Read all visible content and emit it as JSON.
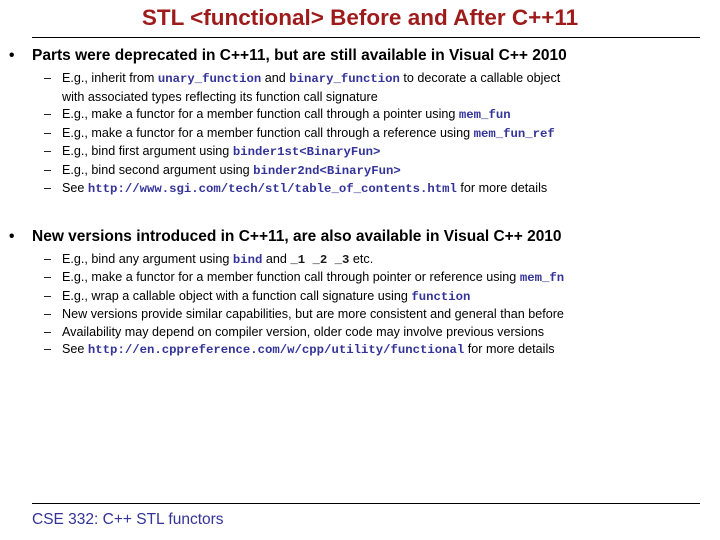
{
  "slide": {
    "title": "STL <functional> Before and After C++11",
    "title_color": "#9E1B1B",
    "code_color": "#333399",
    "footer_color": "#333399",
    "body_color": "#000000",
    "rule_color": "#000000",
    "bullet_glyph": "•",
    "dash_glyph": "–",
    "footer": "CSE 332: C++ STL functors"
  },
  "sections": [
    {
      "heading": "Parts were deprecated in C++11, but are still available in Visual C++ 2010",
      "items": [
        {
          "parts": [
            {
              "type": "text",
              "value": "E.g., inherit from "
            },
            {
              "type": "code",
              "value": "unary_function"
            },
            {
              "type": "text",
              "value": " and "
            },
            {
              "type": "code",
              "value": "binary_function"
            },
            {
              "type": "text",
              "value": " to decorate a callable object"
            }
          ],
          "wrap": "with associated types reflecting its function call signature"
        },
        {
          "parts": [
            {
              "type": "text",
              "value": "E.g., make a functor for a member function call through a pointer using "
            },
            {
              "type": "code",
              "value": "mem_fun"
            }
          ],
          "wrap": ""
        },
        {
          "parts": [
            {
              "type": "text",
              "value": "E.g., make a functor for a member function call through a reference using "
            },
            {
              "type": "code",
              "value": "mem_fun_ref"
            }
          ],
          "wrap": ""
        },
        {
          "parts": [
            {
              "type": "text",
              "value": "E.g., bind first argument using "
            },
            {
              "type": "code",
              "value": "binder1st<BinaryFun>"
            }
          ],
          "wrap": ""
        },
        {
          "parts": [
            {
              "type": "text",
              "value": "E.g., bind second argument using "
            },
            {
              "type": "code",
              "value": "binder2nd<BinaryFun>"
            }
          ],
          "wrap": ""
        },
        {
          "parts": [
            {
              "type": "text",
              "value": "See "
            },
            {
              "type": "code",
              "value": "http://www.sgi.com/tech/stl/table_of_contents.html"
            },
            {
              "type": "text",
              "value": " for more details"
            }
          ],
          "wrap": ""
        }
      ]
    },
    {
      "heading": "New versions introduced in C++11, are also available in Visual C++ 2010",
      "items": [
        {
          "parts": [
            {
              "type": "text",
              "value": "E.g., bind any argument using "
            },
            {
              "type": "code",
              "value": "bind"
            },
            {
              "type": "text",
              "value": " and "
            },
            {
              "type": "code-dark",
              "value": "_1 _2 _3"
            },
            {
              "type": "text",
              "value": " etc."
            }
          ],
          "wrap": ""
        },
        {
          "parts": [
            {
              "type": "text",
              "value": "E.g., make a functor for a member function call through pointer or reference using "
            },
            {
              "type": "code",
              "value": "mem_fn"
            }
          ],
          "wrap": ""
        },
        {
          "parts": [
            {
              "type": "text",
              "value": "E.g., wrap a callable object with a function call signature using "
            },
            {
              "type": "code",
              "value": "function"
            }
          ],
          "wrap": ""
        },
        {
          "parts": [
            {
              "type": "text",
              "value": "New versions provide similar capabilities, but are more consistent and general than before"
            }
          ],
          "wrap": ""
        },
        {
          "parts": [
            {
              "type": "text",
              "value": "Availability may depend on compiler version, older code may involve previous versions"
            }
          ],
          "wrap": ""
        },
        {
          "parts": [
            {
              "type": "text",
              "value": "See "
            },
            {
              "type": "code",
              "value": "http://en.cppreference.com/w/cpp/utility/functional"
            },
            {
              "type": "text",
              "value": " for more details"
            }
          ],
          "wrap": ""
        }
      ]
    }
  ]
}
